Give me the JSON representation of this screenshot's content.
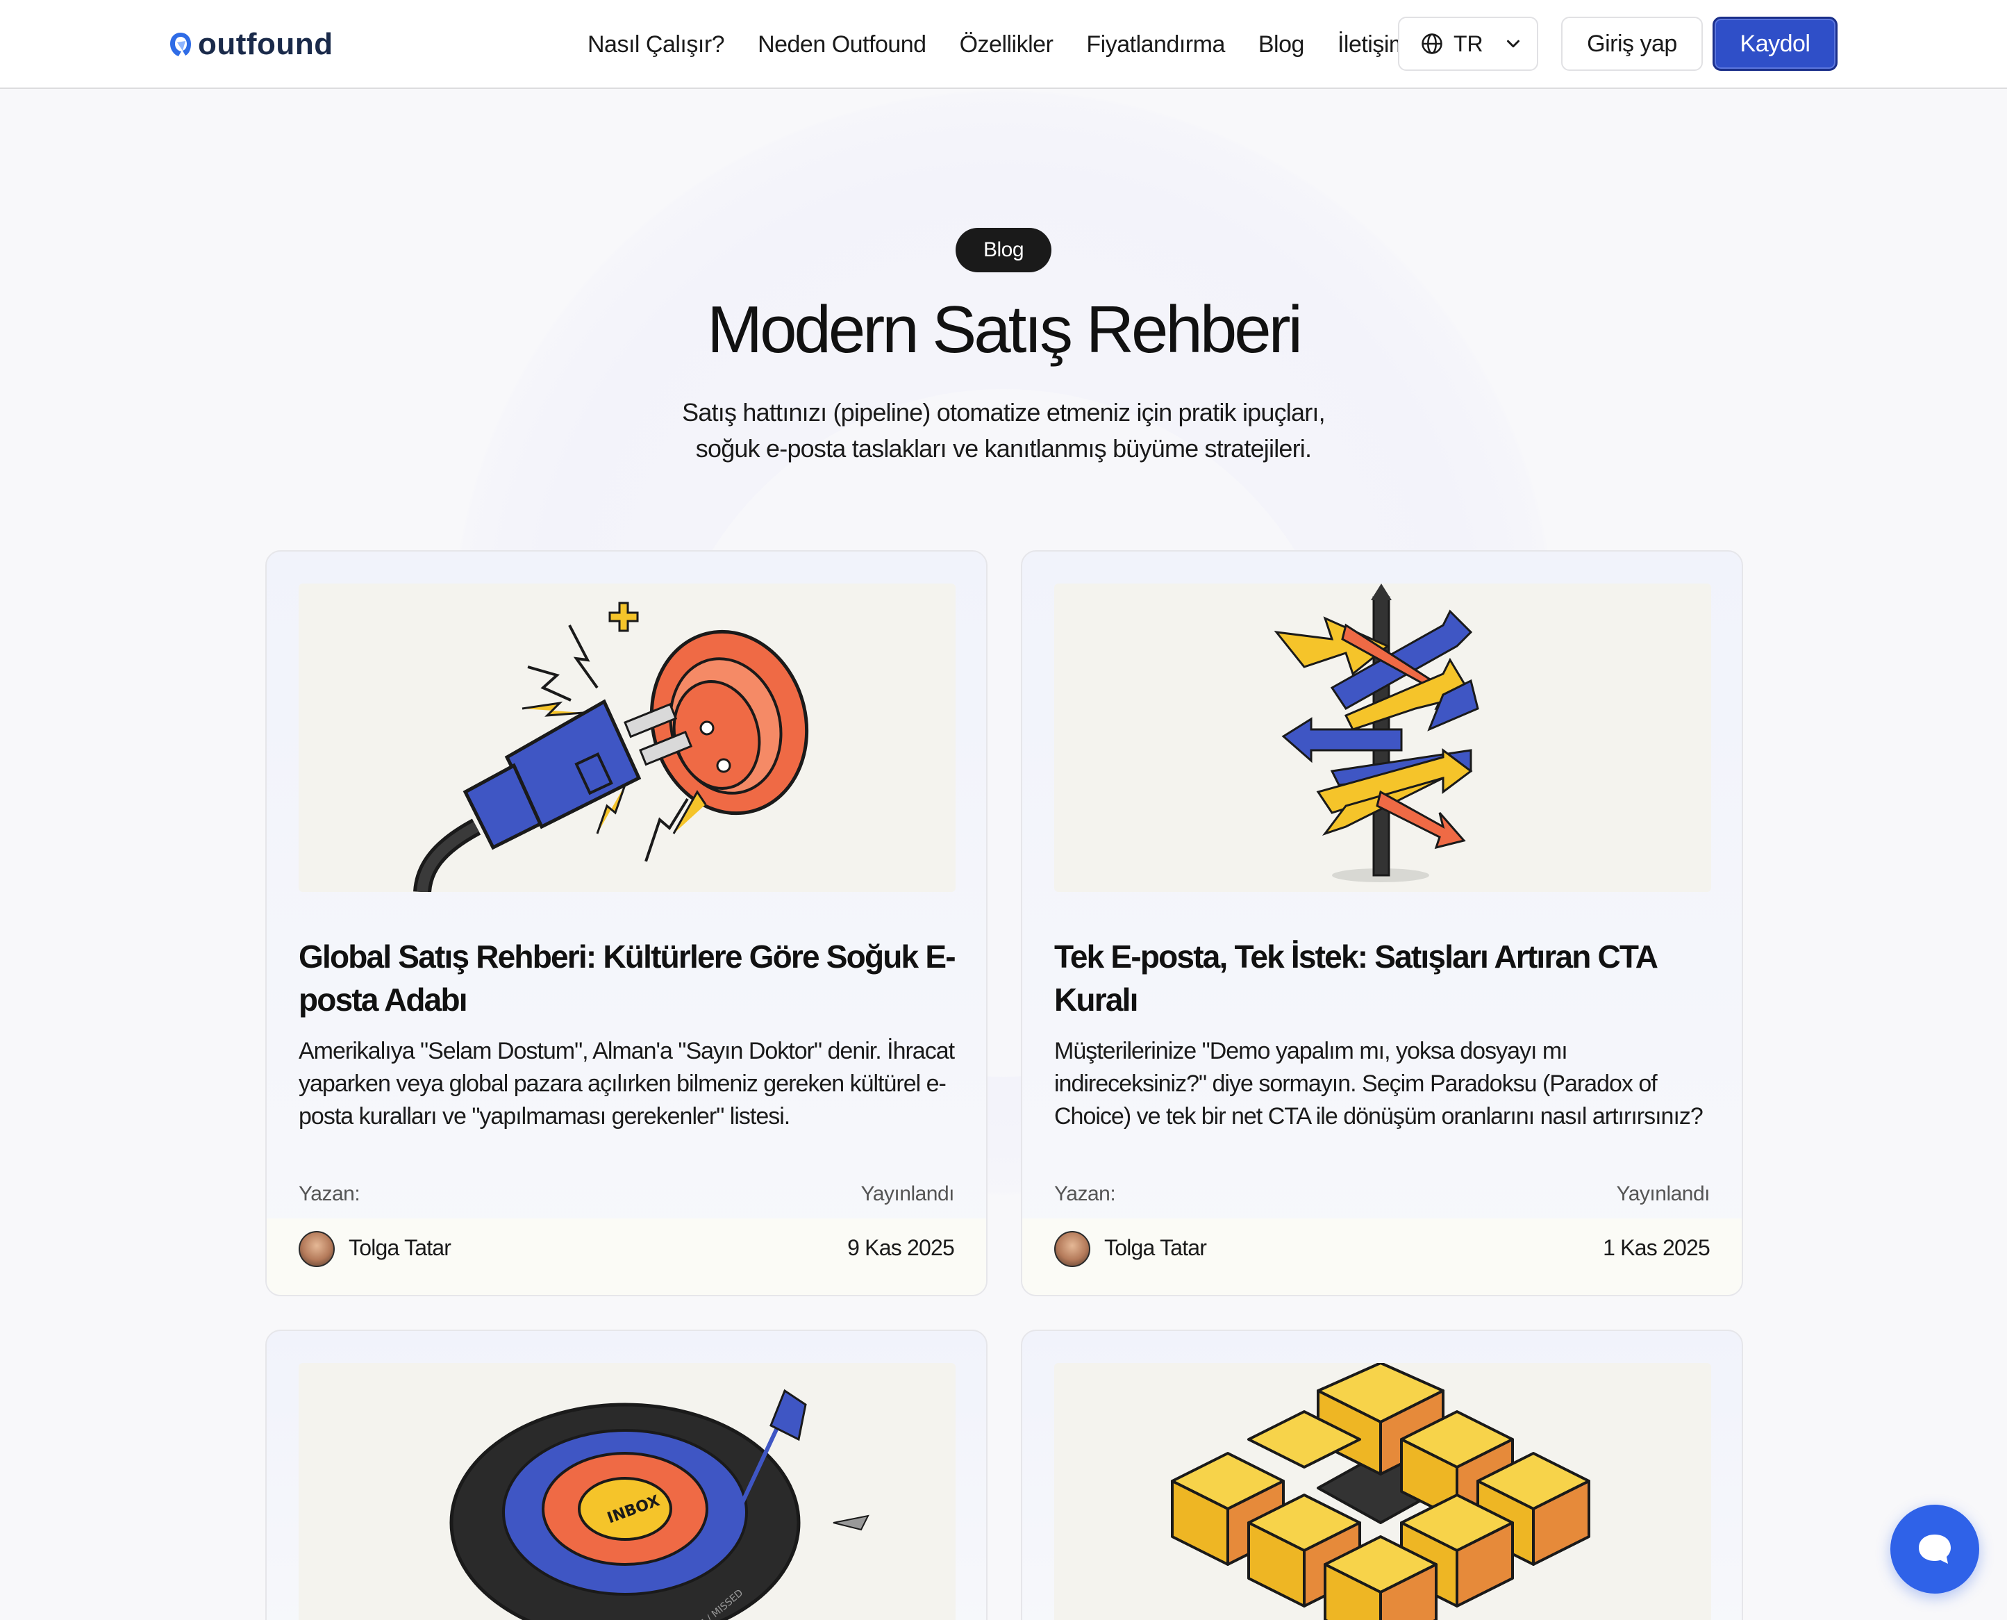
{
  "header": {
    "logo_text": "outfound",
    "nav": [
      {
        "label": "Nasıl Çalışır?"
      },
      {
        "label": "Neden Outfound"
      },
      {
        "label": "Özellikler"
      },
      {
        "label": "Fiyatlandırma"
      },
      {
        "label": "Blog"
      },
      {
        "label": "İletişim"
      }
    ],
    "language": {
      "selected": "TR",
      "icon": "globe-icon"
    },
    "login_label": "Giriş yap",
    "signup_label": "Kaydol"
  },
  "hero": {
    "badge": "Blog",
    "title": "Modern Satış Rehberi",
    "subtitle_line1": "Satış hattınızı (pipeline) otomatize etmeniz için pratik ipuçları,",
    "subtitle_line2": "soğuk e-posta taslakları ve kanıtlanmış büyüme stratejileri."
  },
  "meta_labels": {
    "author": "Yazan:",
    "published": "Yayınlandı"
  },
  "posts": [
    {
      "title": "Global Satış Rehberi: Kültürlere Göre Soğuk E-posta Adabı",
      "description": "Amerikalıya \"Selam Dostum\", Alman'a \"Sayın Doktor\" denir. İhracat yaparken veya global pazara açılırken bilmeniz gereken kültürel e-posta kuralları ve \"yapılmaması gerekenler\" listesi.",
      "author": "Tolga Tatar",
      "date": "9 Kas 2025",
      "image": "plug-socket-illustration"
    },
    {
      "title": "Tek E-posta, Tek İstek: Satışları Artıran CTA Kuralı",
      "description": "Müşterilerinize \"Demo yapalım mı, yoksa dosyayı mı indireceksiniz?\" diye sormayın. Seçim Paradoksu (Paradox of Choice) ve tek bir net CTA ile dönüşüm oranlarını nasıl artırırsınız?",
      "author": "Tolga Tatar",
      "date": "1 Kas 2025",
      "image": "signpost-arrows-illustration"
    },
    {
      "image": "inbox-target-illustration",
      "image_text_1": "INBOX",
      "image_text_2": "SPAM / MISSED"
    },
    {
      "image": "cubes-illustration"
    }
  ],
  "chat": {
    "icon": "chat-bubble-icon"
  },
  "colors": {
    "accent": "#2f4fc8",
    "chat": "#2f62e8",
    "illustration_blue": "#3f56c4",
    "illustration_orange": "#ef6a45",
    "illustration_yellow": "#f5c42a"
  }
}
